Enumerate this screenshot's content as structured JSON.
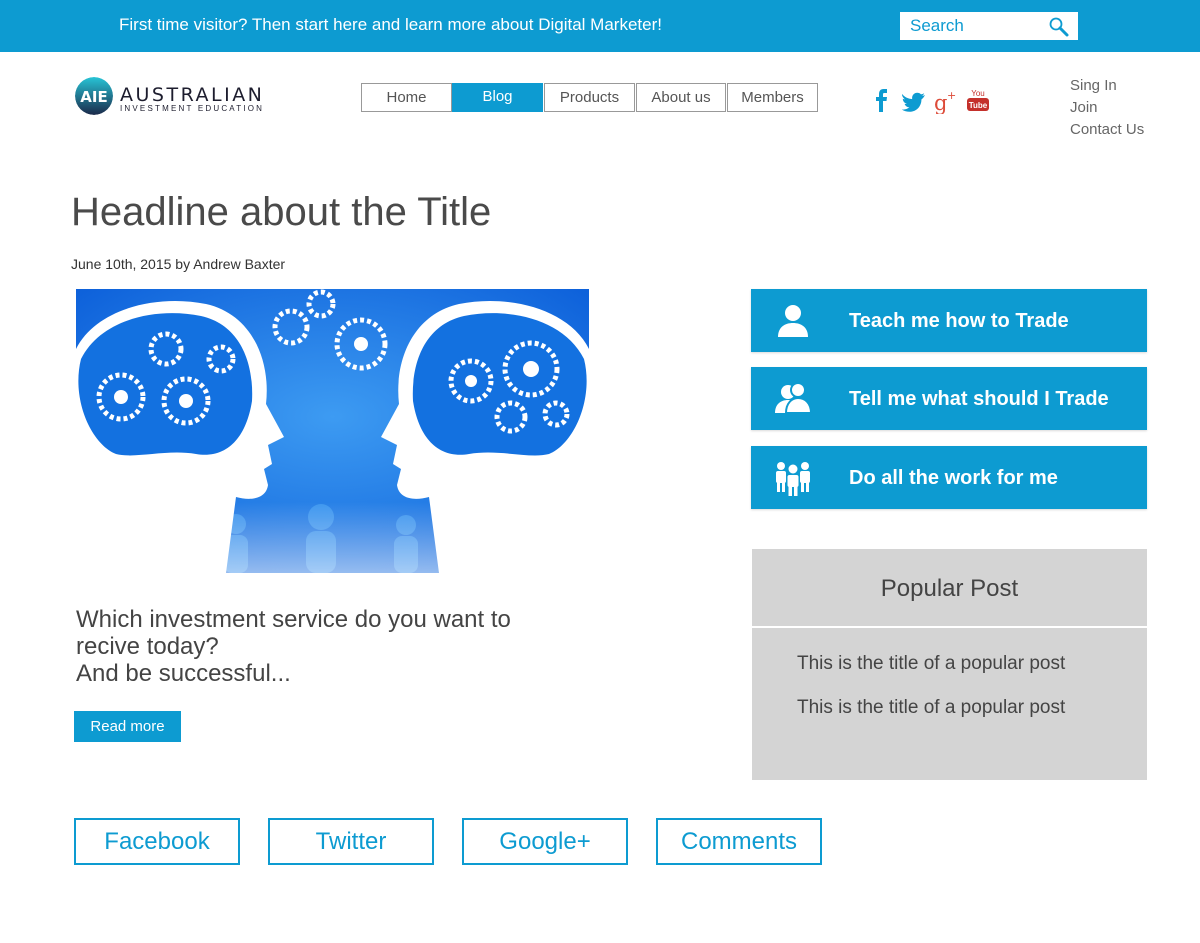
{
  "topbar": {
    "message": "First time visitor? Then start here and learn more about Digital Marketer!",
    "search_placeholder": "Search",
    "accent_color": "#0d9bd1"
  },
  "logo": {
    "name": "AUSTRALIAN",
    "tagline": "INVESTMENT EDUCATION"
  },
  "nav": {
    "items": [
      {
        "label": "Home"
      },
      {
        "label": "Blog",
        "active": true
      },
      {
        "label": "Products"
      },
      {
        "label": "About us"
      },
      {
        "label": "Members"
      }
    ]
  },
  "social": {
    "icons": [
      "facebook-icon",
      "twitter-icon",
      "google-plus-icon",
      "youtube-icon"
    ],
    "youtube_label": "You Tube"
  },
  "account": {
    "links": [
      "Sing In",
      "Join",
      "Contact Us"
    ]
  },
  "article": {
    "headline": "Headline about the Title",
    "byline": "June 10th, 2015 by Andrew Baxter",
    "image_icon": "heads-with-gears-illustration",
    "teaser_lines": [
      "Which investment service do you want to",
      "recive today?",
      "And be successful..."
    ],
    "read_more_label": "Read more"
  },
  "services": [
    {
      "label": "Teach me how to Trade",
      "icon": "user-icon"
    },
    {
      "label": "Tell me what should I Trade",
      "icon": "users-icon"
    },
    {
      "label": "Do all the work for me",
      "icon": "team-icon"
    }
  ],
  "popular": {
    "title": "Popular Post",
    "posts": [
      "This is the title of a popular post",
      "This is the title of a popular post"
    ]
  },
  "share": {
    "buttons": [
      "Facebook",
      "Twitter",
      "Google+",
      "Comments"
    ]
  }
}
